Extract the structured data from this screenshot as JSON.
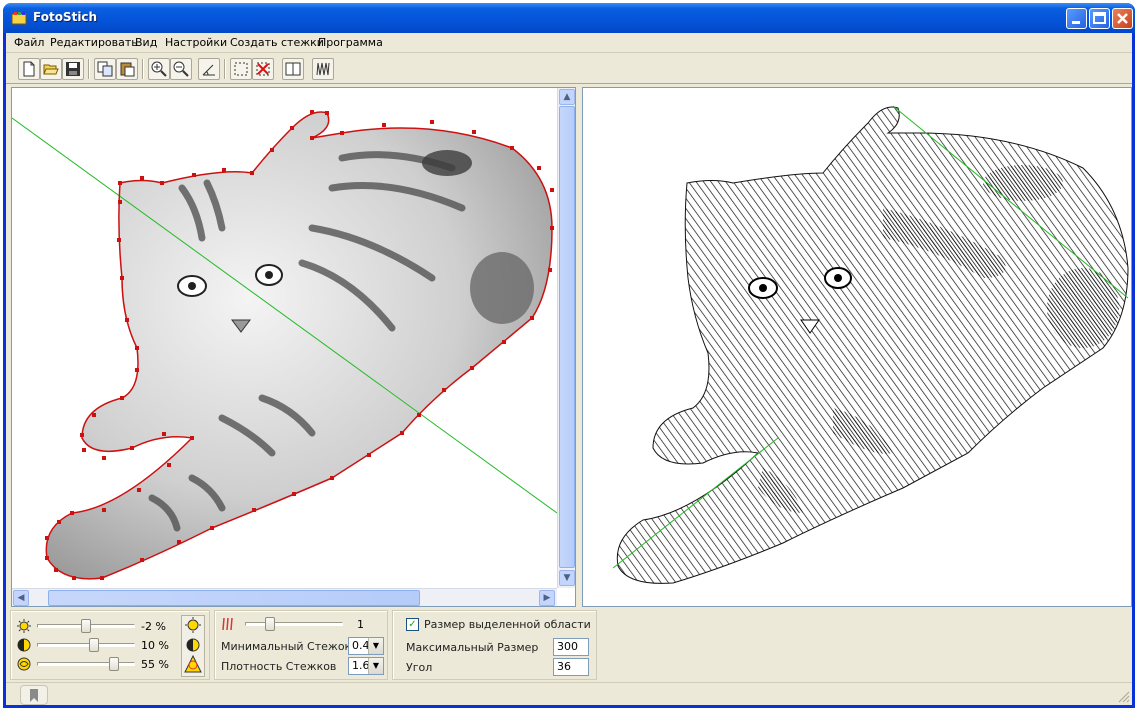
{
  "window": {
    "title": "FotoStich"
  },
  "menu": [
    "Файл",
    "Редактировать",
    "Вид",
    "Настройки",
    "Создать стежки",
    "Программа"
  ],
  "toolbar": {
    "buttons": [
      "new-icon",
      "open-icon",
      "save-icon",
      "copy-icon",
      "paste-icon",
      "zoom-in-icon",
      "zoom-out-icon",
      "angle-icon",
      "select-rect-icon",
      "clear-selection-icon",
      "split-view-icon",
      "stitch-icon"
    ]
  },
  "adjustments": {
    "brightness": {
      "icon": "sun-icon",
      "value": "-2 %",
      "level": 0.45
    },
    "contrast": {
      "icon": "contrast-icon",
      "value": "10 %",
      "level": 0.55
    },
    "saturation": {
      "icon": "saturation-icon",
      "value": "55 %",
      "level": 0.75
    }
  },
  "stitch_settings": {
    "slider_value": "1",
    "slider_level": 0.25,
    "min_stitch_label": "Минимальный Стежок",
    "min_stitch_value": "0.4",
    "density_label": "Плотность Стежков",
    "density_value": "1.6"
  },
  "selection": {
    "size_checkbox_label": "Размер выделенной области",
    "size_checked": true,
    "max_size_label": "Максимальный Размер",
    "max_size_value": "300",
    "angle_label": "Угол",
    "angle_value": "36"
  },
  "colors": {
    "outline": "#cc1111",
    "guide_line": "#22bb22",
    "titlebar": "#0453d8"
  }
}
